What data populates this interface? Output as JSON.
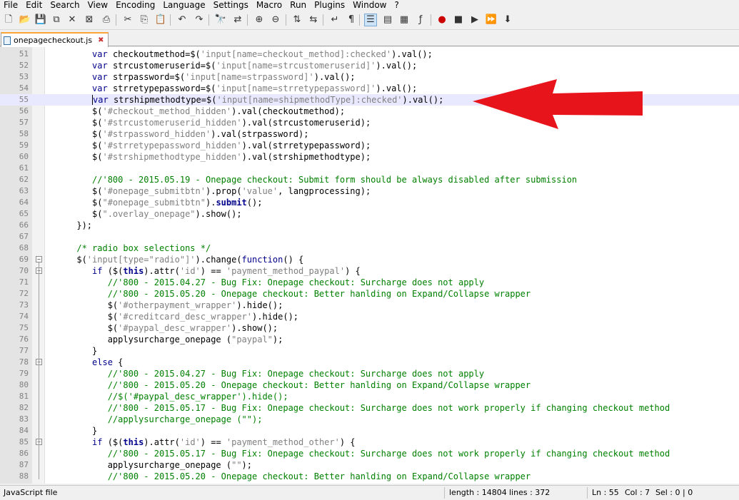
{
  "menu": [
    "File",
    "Edit",
    "Search",
    "View",
    "Encoding",
    "Language",
    "Settings",
    "Macro",
    "Run",
    "Plugins",
    "Window",
    "?"
  ],
  "toolbar_icons": [
    {
      "name": "new-file-icon",
      "glyph": "🗋"
    },
    {
      "name": "open-file-icon",
      "glyph": "📂"
    },
    {
      "name": "save-icon",
      "glyph": "💾"
    },
    {
      "name": "save-all-icon",
      "glyph": "⧉"
    },
    {
      "name": "close-icon",
      "glyph": "✕"
    },
    {
      "name": "close-all-icon",
      "glyph": "⊠"
    },
    {
      "name": "print-icon",
      "glyph": "⎙"
    },
    {
      "name": "cut-icon",
      "glyph": "✂"
    },
    {
      "name": "copy-icon",
      "glyph": "⎘"
    },
    {
      "name": "paste-icon",
      "glyph": "📋"
    },
    {
      "name": "undo-icon",
      "glyph": "↶"
    },
    {
      "name": "redo-icon",
      "glyph": "↷"
    },
    {
      "name": "find-icon",
      "glyph": "🔭"
    },
    {
      "name": "replace-icon",
      "glyph": "⇄"
    },
    {
      "name": "zoom-in-icon",
      "glyph": "⊕"
    },
    {
      "name": "zoom-out-icon",
      "glyph": "⊖"
    },
    {
      "name": "sync-vertical-icon",
      "glyph": "⇅"
    },
    {
      "name": "sync-horizontal-icon",
      "glyph": "⇆"
    },
    {
      "name": "word-wrap-icon",
      "glyph": "↵"
    },
    {
      "name": "show-all-chars-icon",
      "glyph": "¶"
    },
    {
      "name": "indent-guide-icon",
      "glyph": "☰"
    },
    {
      "name": "user-language-icon",
      "glyph": "▤"
    },
    {
      "name": "doc-map-icon",
      "glyph": "▦"
    },
    {
      "name": "function-list-icon",
      "glyph": "ƒ"
    },
    {
      "name": "record-macro-icon",
      "glyph": "●"
    },
    {
      "name": "stop-macro-icon",
      "glyph": "■"
    },
    {
      "name": "play-macro-icon",
      "glyph": "▶"
    },
    {
      "name": "run-macro-multiple-icon",
      "glyph": "⏩"
    },
    {
      "name": "save-macro-icon",
      "glyph": "⬇"
    }
  ],
  "tab": {
    "label": "onepagecheckout.js",
    "close_glyph": "✖"
  },
  "lines": [
    {
      "n": "51",
      "parts": [
        [
          "",
          "         "
        ],
        [
          "k",
          "var"
        ],
        [
          "",
          " checkoutmethod=$("
        ],
        [
          "s",
          "'input[name=checkout_method]:checked'"
        ],
        [
          "",
          ").val();"
        ]
      ]
    },
    {
      "n": "52",
      "parts": [
        [
          "",
          "         "
        ],
        [
          "k",
          "var"
        ],
        [
          "",
          " strcustomeruserid=$("
        ],
        [
          "s",
          "'input[name=strcustomeruserid]'"
        ],
        [
          "",
          ").val();"
        ]
      ]
    },
    {
      "n": "53",
      "parts": [
        [
          "",
          "         "
        ],
        [
          "k",
          "var"
        ],
        [
          "",
          " strpassword=$("
        ],
        [
          "s",
          "'input[name=strpassword]'"
        ],
        [
          "",
          ").val();"
        ]
      ]
    },
    {
      "n": "54",
      "parts": [
        [
          "",
          "         "
        ],
        [
          "k",
          "var"
        ],
        [
          "",
          " strretypepassword=$("
        ],
        [
          "s",
          "'input[name=strretypepassword]'"
        ],
        [
          "",
          ").val();"
        ]
      ]
    },
    {
      "n": "55",
      "current": true,
      "parts": [
        [
          "",
          "         "
        ],
        [
          "k",
          "var"
        ],
        [
          "",
          " strshipmethodtype=$("
        ],
        [
          "s",
          "'input[name=shipmethodType]:checked'"
        ],
        [
          "",
          ").val();"
        ]
      ]
    },
    {
      "n": "56",
      "parts": [
        [
          "",
          "         $("
        ],
        [
          "s",
          "'#checkout_method_hidden'"
        ],
        [
          "",
          ").val(checkoutmethod);"
        ]
      ]
    },
    {
      "n": "57",
      "parts": [
        [
          "",
          "         $("
        ],
        [
          "s",
          "'#strcustomeruserid_hidden'"
        ],
        [
          "",
          ").val(strcustomeruserid);"
        ]
      ]
    },
    {
      "n": "58",
      "parts": [
        [
          "",
          "         $("
        ],
        [
          "s",
          "'#strpassword_hidden'"
        ],
        [
          "",
          ").val(strpassword);"
        ]
      ]
    },
    {
      "n": "59",
      "parts": [
        [
          "",
          "         $("
        ],
        [
          "s",
          "'#strretypepassword_hidden'"
        ],
        [
          "",
          ").val(strretypepassword);"
        ]
      ]
    },
    {
      "n": "60",
      "parts": [
        [
          "",
          "         $("
        ],
        [
          "s",
          "'#strshipmethodtype_hidden'"
        ],
        [
          "",
          ").val(strshipmethodtype);"
        ]
      ]
    },
    {
      "n": "61",
      "parts": [
        [
          "",
          ""
        ]
      ]
    },
    {
      "n": "62",
      "parts": [
        [
          "",
          "         "
        ],
        [
          "c",
          "//'800 - 2015.05.19 - Onepage checkout: Submit form should be always disabled after submission"
        ]
      ]
    },
    {
      "n": "63",
      "parts": [
        [
          "",
          "         $("
        ],
        [
          "s",
          "'#onepage_submitbtn'"
        ],
        [
          "",
          ").prop("
        ],
        [
          "s",
          "'value'"
        ],
        [
          "",
          ", langprocessing);"
        ]
      ]
    },
    {
      "n": "64",
      "parts": [
        [
          "",
          "         $("
        ],
        [
          "s",
          "\"#onepage_submitbtn\""
        ],
        [
          "",
          ")."
        ],
        [
          "kb",
          "submit"
        ],
        [
          "",
          "();"
        ]
      ]
    },
    {
      "n": "65",
      "parts": [
        [
          "",
          "         $("
        ],
        [
          "s",
          "\".overlay_onepage\""
        ],
        [
          "",
          ").show();"
        ]
      ]
    },
    {
      "n": "66",
      "parts": [
        [
          "",
          "      });"
        ]
      ]
    },
    {
      "n": "67",
      "parts": [
        [
          "",
          ""
        ]
      ]
    },
    {
      "n": "68",
      "parts": [
        [
          "",
          "      "
        ],
        [
          "c",
          "/* radio box selections */"
        ]
      ]
    },
    {
      "n": "69",
      "fold": "−",
      "parts": [
        [
          "",
          "      $("
        ],
        [
          "s",
          "'input[type=\"radio\"]'"
        ],
        [
          "",
          ").change("
        ],
        [
          "k",
          "function"
        ],
        [
          "",
          "() {"
        ]
      ]
    },
    {
      "n": "70",
      "fold": "−",
      "parts": [
        [
          "",
          "         "
        ],
        [
          "k",
          "if"
        ],
        [
          "",
          " ($("
        ],
        [
          "kb",
          "this"
        ],
        [
          "",
          ").attr("
        ],
        [
          "s",
          "'id'"
        ],
        [
          "",
          ") == "
        ],
        [
          "s",
          "'payment_method_paypal'"
        ],
        [
          "",
          ") {"
        ]
      ]
    },
    {
      "n": "71",
      "parts": [
        [
          "",
          "            "
        ],
        [
          "c",
          "//'800 - 2015.04.27 - Bug Fix: Onepage checkout: Surcharge does not apply"
        ]
      ]
    },
    {
      "n": "72",
      "parts": [
        [
          "",
          "            "
        ],
        [
          "c",
          "//'800 - 2015.05.20 - Onepage checkout: Better hanlding on Expand/Collapse wrapper"
        ]
      ]
    },
    {
      "n": "73",
      "parts": [
        [
          "",
          "            $("
        ],
        [
          "s",
          "'#otherpayment_wrapper'"
        ],
        [
          "",
          ").hide();"
        ]
      ]
    },
    {
      "n": "74",
      "parts": [
        [
          "",
          "            $("
        ],
        [
          "s",
          "'#creditcard_desc_wrapper'"
        ],
        [
          "",
          ").hide();"
        ]
      ]
    },
    {
      "n": "75",
      "parts": [
        [
          "",
          "            $("
        ],
        [
          "s",
          "'#paypal_desc_wrapper'"
        ],
        [
          "",
          ").show();"
        ]
      ]
    },
    {
      "n": "76",
      "parts": [
        [
          "",
          "            applysurcharge_onepage ("
        ],
        [
          "s",
          "\"paypal\""
        ],
        [
          "",
          ");"
        ]
      ]
    },
    {
      "n": "77",
      "parts": [
        [
          "",
          "         }"
        ]
      ]
    },
    {
      "n": "78",
      "fold": "−",
      "parts": [
        [
          "",
          "         "
        ],
        [
          "k",
          "else"
        ],
        [
          "",
          " {"
        ]
      ]
    },
    {
      "n": "79",
      "parts": [
        [
          "",
          "            "
        ],
        [
          "c",
          "//'800 - 2015.04.27 - Bug Fix: Onepage checkout: Surcharge does not apply"
        ]
      ]
    },
    {
      "n": "80",
      "parts": [
        [
          "",
          "            "
        ],
        [
          "c",
          "//'800 - 2015.05.20 - Onepage checkout: Better hanlding on Expand/Collapse wrapper"
        ]
      ]
    },
    {
      "n": "81",
      "parts": [
        [
          "",
          "            "
        ],
        [
          "c",
          "//$('#paypal_desc_wrapper').hide();"
        ]
      ]
    },
    {
      "n": "82",
      "parts": [
        [
          "",
          "            "
        ],
        [
          "c",
          "//'800 - 2015.05.17 - Bug Fix: Onepage checkout: Surcharge does not work properly if changing checkout method"
        ]
      ]
    },
    {
      "n": "83",
      "parts": [
        [
          "",
          "            "
        ],
        [
          "c",
          "//applysurcharge_onepage (\"\");"
        ]
      ]
    },
    {
      "n": "84",
      "parts": [
        [
          "",
          "         }"
        ]
      ]
    },
    {
      "n": "85",
      "fold": "−",
      "parts": [
        [
          "",
          "         "
        ],
        [
          "k",
          "if"
        ],
        [
          "",
          " ($("
        ],
        [
          "kb",
          "this"
        ],
        [
          "",
          ").attr("
        ],
        [
          "s",
          "'id'"
        ],
        [
          "",
          ") == "
        ],
        [
          "s",
          "'payment_method_other'"
        ],
        [
          "",
          ") {"
        ]
      ]
    },
    {
      "n": "86",
      "parts": [
        [
          "",
          "            "
        ],
        [
          "c",
          "//'800 - 2015.05.17 - Bug Fix: Onepage checkout: Surcharge does not work properly if changing checkout method"
        ]
      ]
    },
    {
      "n": "87",
      "parts": [
        [
          "",
          "            applysurcharge_onepage ("
        ],
        [
          "s",
          "\"\""
        ],
        [
          "",
          ");"
        ]
      ]
    },
    {
      "n": "88",
      "parts": [
        [
          "",
          "            "
        ],
        [
          "c",
          "//'800 - 2015.05.20 - Onepage checkout: Better hanlding on Expand/Collapse wrapper"
        ]
      ]
    }
  ],
  "status": {
    "file_type": "JavaScript file",
    "length": "length : 14804",
    "lines": "lines : 372",
    "ln": "Ln : 55",
    "col": "Col : 7",
    "sel": "Sel : 0 | 0"
  },
  "colors": {
    "annotation_arrow": "#e8141c",
    "current_line": "#e8e8ff",
    "keyword": "#00008b",
    "string": "#808080",
    "comment": "#008000"
  }
}
